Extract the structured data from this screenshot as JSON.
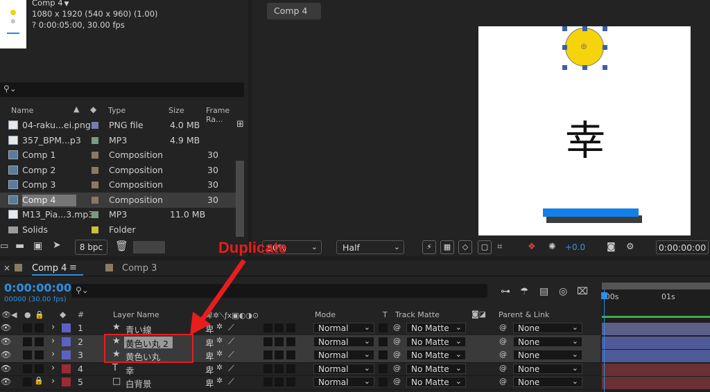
{
  "project_panel": {
    "comp_name": "Comp 4",
    "comp_dims": "1080 x 1920  (540 x 960) (1.00)",
    "comp_duration": "? 0:00:05:00, 30.00 fps",
    "search_placeholder": "",
    "columns": {
      "name": "Name",
      "type": "Type",
      "size": "Size",
      "frame_rate": "Frame Ra..."
    },
    "items": [
      {
        "name": "04-raku...ei.png",
        "type": "PNG file",
        "size": "4.0 MB",
        "fps": "",
        "color": "#7a7bb3"
      },
      {
        "name": "357_BPM...p3",
        "type": "MP3",
        "size": "4.9 MB",
        "fps": "",
        "color": "#7a9b83"
      },
      {
        "name": "Comp 1",
        "type": "Composition",
        "size": "",
        "fps": "30",
        "color": "#8a7a62"
      },
      {
        "name": "Comp 2",
        "type": "Composition",
        "size": "",
        "fps": "30",
        "color": "#8a7a62"
      },
      {
        "name": "Comp 3",
        "type": "Composition",
        "size": "",
        "fps": "30",
        "color": "#8a7a62"
      },
      {
        "name": "Comp 4",
        "type": "Composition",
        "size": "",
        "fps": "30",
        "color": "#8a7a62"
      },
      {
        "name": "M13_Pia...3.mp3",
        "type": "MP3",
        "size": "11.0 MB",
        "fps": "",
        "color": "#7a9b83"
      },
      {
        "name": "Solids",
        "type": "Folder",
        "size": "",
        "fps": "",
        "color": "#c9c23a"
      }
    ],
    "bpc": "8 bpc"
  },
  "viewer": {
    "tab": "Comp 4",
    "kanji": "幸",
    "zoom": "50%",
    "resolution": "Half",
    "exposure": "+0.0",
    "time": "0:00:00:00"
  },
  "timeline": {
    "tabs": [
      {
        "label": "Comp 4"
      },
      {
        "label": "Comp 3"
      }
    ],
    "timecode": "0:00:00:00",
    "fps": "00000 (30.00 fps)",
    "columns": {
      "num": "#",
      "layer_name": "Layer Name",
      "mode": "Mode",
      "t": "T",
      "track_matte": "Track Matte",
      "parent": "Parent & Link"
    },
    "ruler": {
      "start": ":00s",
      "mark": "01s"
    },
    "layers": [
      {
        "num": "1",
        "name": "青い線",
        "mode": "Normal",
        "matte": "No Matte",
        "parent": "None",
        "color": "#5b62c4",
        "track": "#5c5f87"
      },
      {
        "num": "2",
        "name": "黄色い丸 2",
        "mode": "Normal",
        "matte": "No Matte",
        "parent": "None",
        "color": "#5b62c4",
        "track": "#4f5a99"
      },
      {
        "num": "3",
        "name": "黄色い丸",
        "mode": "Normal",
        "matte": "No Matte",
        "parent": "None",
        "color": "#5b62c4",
        "track": "#4f5a99"
      },
      {
        "num": "4",
        "name": "幸",
        "mode": "Normal",
        "matte": "No Matte",
        "parent": "None",
        "color": "#9c2c33",
        "track": "#6a3034"
      },
      {
        "num": "5",
        "name": "白背景",
        "mode": "Normal",
        "matte": "No Matte",
        "parent": "None",
        "color": "#9c2c33",
        "track": "#6a3034"
      }
    ]
  },
  "annotation": {
    "label": "Duplicate",
    "color": "#ec1b1b"
  }
}
